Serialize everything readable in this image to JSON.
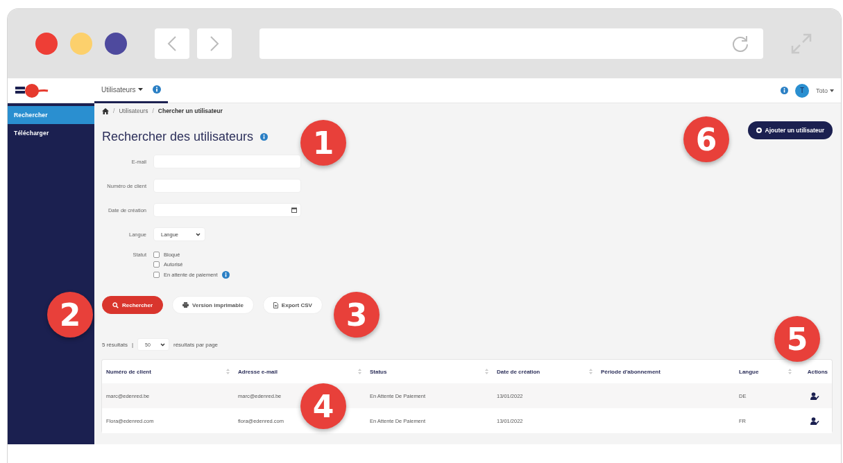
{
  "browser": {
    "window_buttons": [
      {
        "color": "#ee3e36"
      },
      {
        "color": "#fcd06c"
      },
      {
        "color": "#4e4a9e"
      }
    ]
  },
  "navbar": {
    "menu": "Utilisateurs",
    "user": "Toto",
    "avatar": "T"
  },
  "sidebar": {
    "items": [
      {
        "label": "Rechercher",
        "selected": true
      },
      {
        "label": "Télécharger",
        "selected": false
      }
    ]
  },
  "breadcrumb": {
    "separator": "/",
    "items": [
      "Utilisateurs",
      "Chercher un utilisateur"
    ]
  },
  "page_title": "Rechercher des utilisateurs",
  "add_button": "Ajouter un utilisateur",
  "form": {
    "fields": [
      {
        "kind": "text",
        "label": "E-mail"
      },
      {
        "kind": "text",
        "label": "Numéro de client"
      },
      {
        "kind": "date",
        "label": "Date de création"
      },
      {
        "kind": "select",
        "label": "Langue",
        "value": "Langue"
      }
    ],
    "status": {
      "label": "Statut",
      "options": [
        {
          "label": "Bloqué",
          "checked": false,
          "info": false
        },
        {
          "label": "Autorisé",
          "checked": false,
          "info": false
        },
        {
          "label": "En attente de paiement",
          "checked": false,
          "info": true
        }
      ]
    }
  },
  "buttons": [
    {
      "kind": "search",
      "label": "Rechercher"
    },
    {
      "kind": "print",
      "label": "Version imprimable"
    },
    {
      "kind": "csv",
      "label": "Export CSV"
    }
  ],
  "results": {
    "count": "5 résultats",
    "separator": "|",
    "per_page": "50",
    "per_page_label": "résultats par page"
  },
  "table": {
    "columns": [
      {
        "label": "Numéro de client",
        "sortable": true
      },
      {
        "label": "Adresse e-mail",
        "sortable": true
      },
      {
        "label": "Status",
        "sortable": true
      },
      {
        "label": "Date de création",
        "sortable": true
      },
      {
        "label": "Période d'abonnement",
        "sortable": false
      },
      {
        "label": "Langue",
        "sortable": true
      },
      {
        "label": "Actions",
        "sortable": false
      }
    ],
    "rows": [
      {
        "client": "marc@edenred.be",
        "email": "marc@edenred.be",
        "status": "En Attente De Paiement",
        "date": "13/01/2022",
        "language": "DE"
      },
      {
        "client": "Flora@edenred.com",
        "email": "flora@edenred.com",
        "status": "En Attente De Paiement",
        "date": "13/01/2022",
        "language": "FR"
      }
    ]
  },
  "callouts": [
    "1",
    "2",
    "3",
    "4",
    "5",
    "6"
  ]
}
